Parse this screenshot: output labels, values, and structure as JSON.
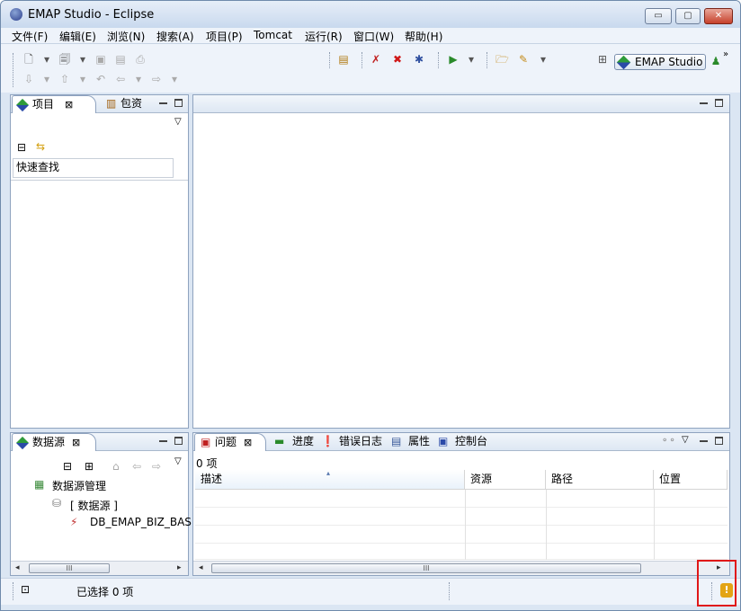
{
  "window": {
    "title": "EMAP Studio  -  Eclipse",
    "btn_min": "▭",
    "btn_max": "▢",
    "btn_close": "✕"
  },
  "menu": [
    "文件(F)",
    "编辑(E)",
    "浏览(N)",
    "搜索(A)",
    "项目(P)",
    "Tomcat",
    "运行(R)",
    "窗口(W)",
    "帮助(H)"
  ],
  "perspective": {
    "label": "EMAP Studio"
  },
  "project_panel": {
    "tab_active": "项目",
    "tab_other": "包资",
    "quick_find": "快速查找"
  },
  "datasource_panel": {
    "tab_active": "数据源",
    "tree": [
      "数据源管理",
      "[ 数据源 ]",
      "DB_EMAP_BIZ_BAS"
    ],
    "scroll_label": "III"
  },
  "bottom_panel": {
    "tabs": [
      "问题",
      "进度",
      "错误日志",
      "属性",
      "控制台"
    ],
    "count": "0 项",
    "columns": [
      "描述",
      "资源",
      "路径",
      "位置"
    ],
    "scroll_label": "III"
  },
  "status": {
    "selected": "已选择 0 项"
  },
  "icons": {
    "warning": "!"
  },
  "colors": {
    "accent": "#2b4aa8",
    "highlight": "#e01818"
  }
}
